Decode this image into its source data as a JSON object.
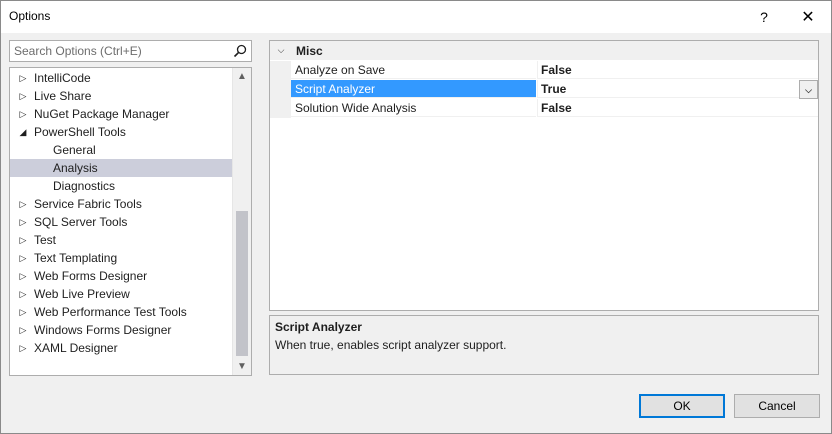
{
  "window": {
    "title": "Options",
    "help_glyph": "?",
    "close_glyph": "✕"
  },
  "search": {
    "placeholder": "Search Options (Ctrl+E)",
    "icon": "search-icon"
  },
  "tree": {
    "items": [
      {
        "label": "IntelliCode",
        "expander": "collapsed",
        "indent": 0
      },
      {
        "label": "Live Share",
        "expander": "collapsed",
        "indent": 0
      },
      {
        "label": "NuGet Package Manager",
        "expander": "collapsed",
        "indent": 0
      },
      {
        "label": "PowerShell Tools",
        "expander": "expanded",
        "indent": 0
      },
      {
        "label": "General",
        "expander": "none",
        "indent": 1
      },
      {
        "label": "Analysis",
        "expander": "none",
        "indent": 1,
        "selected": true
      },
      {
        "label": "Diagnostics",
        "expander": "none",
        "indent": 1
      },
      {
        "label": "Service Fabric Tools",
        "expander": "collapsed",
        "indent": 0
      },
      {
        "label": "SQL Server Tools",
        "expander": "collapsed",
        "indent": 0
      },
      {
        "label": "Test",
        "expander": "collapsed",
        "indent": 0
      },
      {
        "label": "Text Templating",
        "expander": "collapsed",
        "indent": 0
      },
      {
        "label": "Web Forms Designer",
        "expander": "collapsed",
        "indent": 0
      },
      {
        "label": "Web Live Preview",
        "expander": "collapsed",
        "indent": 0
      },
      {
        "label": "Web Performance Test Tools",
        "expander": "collapsed",
        "indent": 0
      },
      {
        "label": "Windows Forms Designer",
        "expander": "collapsed",
        "indent": 0
      },
      {
        "label": "XAML Designer",
        "expander": "collapsed",
        "indent": 0
      }
    ]
  },
  "grid": {
    "category": "Misc",
    "properties": [
      {
        "name": "Analyze on Save",
        "value": "False"
      },
      {
        "name": "Script Analyzer",
        "value": "True",
        "selected": true
      },
      {
        "name": "Solution Wide Analysis",
        "value": "False"
      }
    ]
  },
  "description": {
    "title": "Script Analyzer",
    "text": "When true, enables script analyzer support."
  },
  "buttons": {
    "ok": "OK",
    "cancel": "Cancel"
  },
  "colors": {
    "accent": "#0078d7",
    "selection": "#3399ff",
    "tree_selection": "#cccedb"
  }
}
